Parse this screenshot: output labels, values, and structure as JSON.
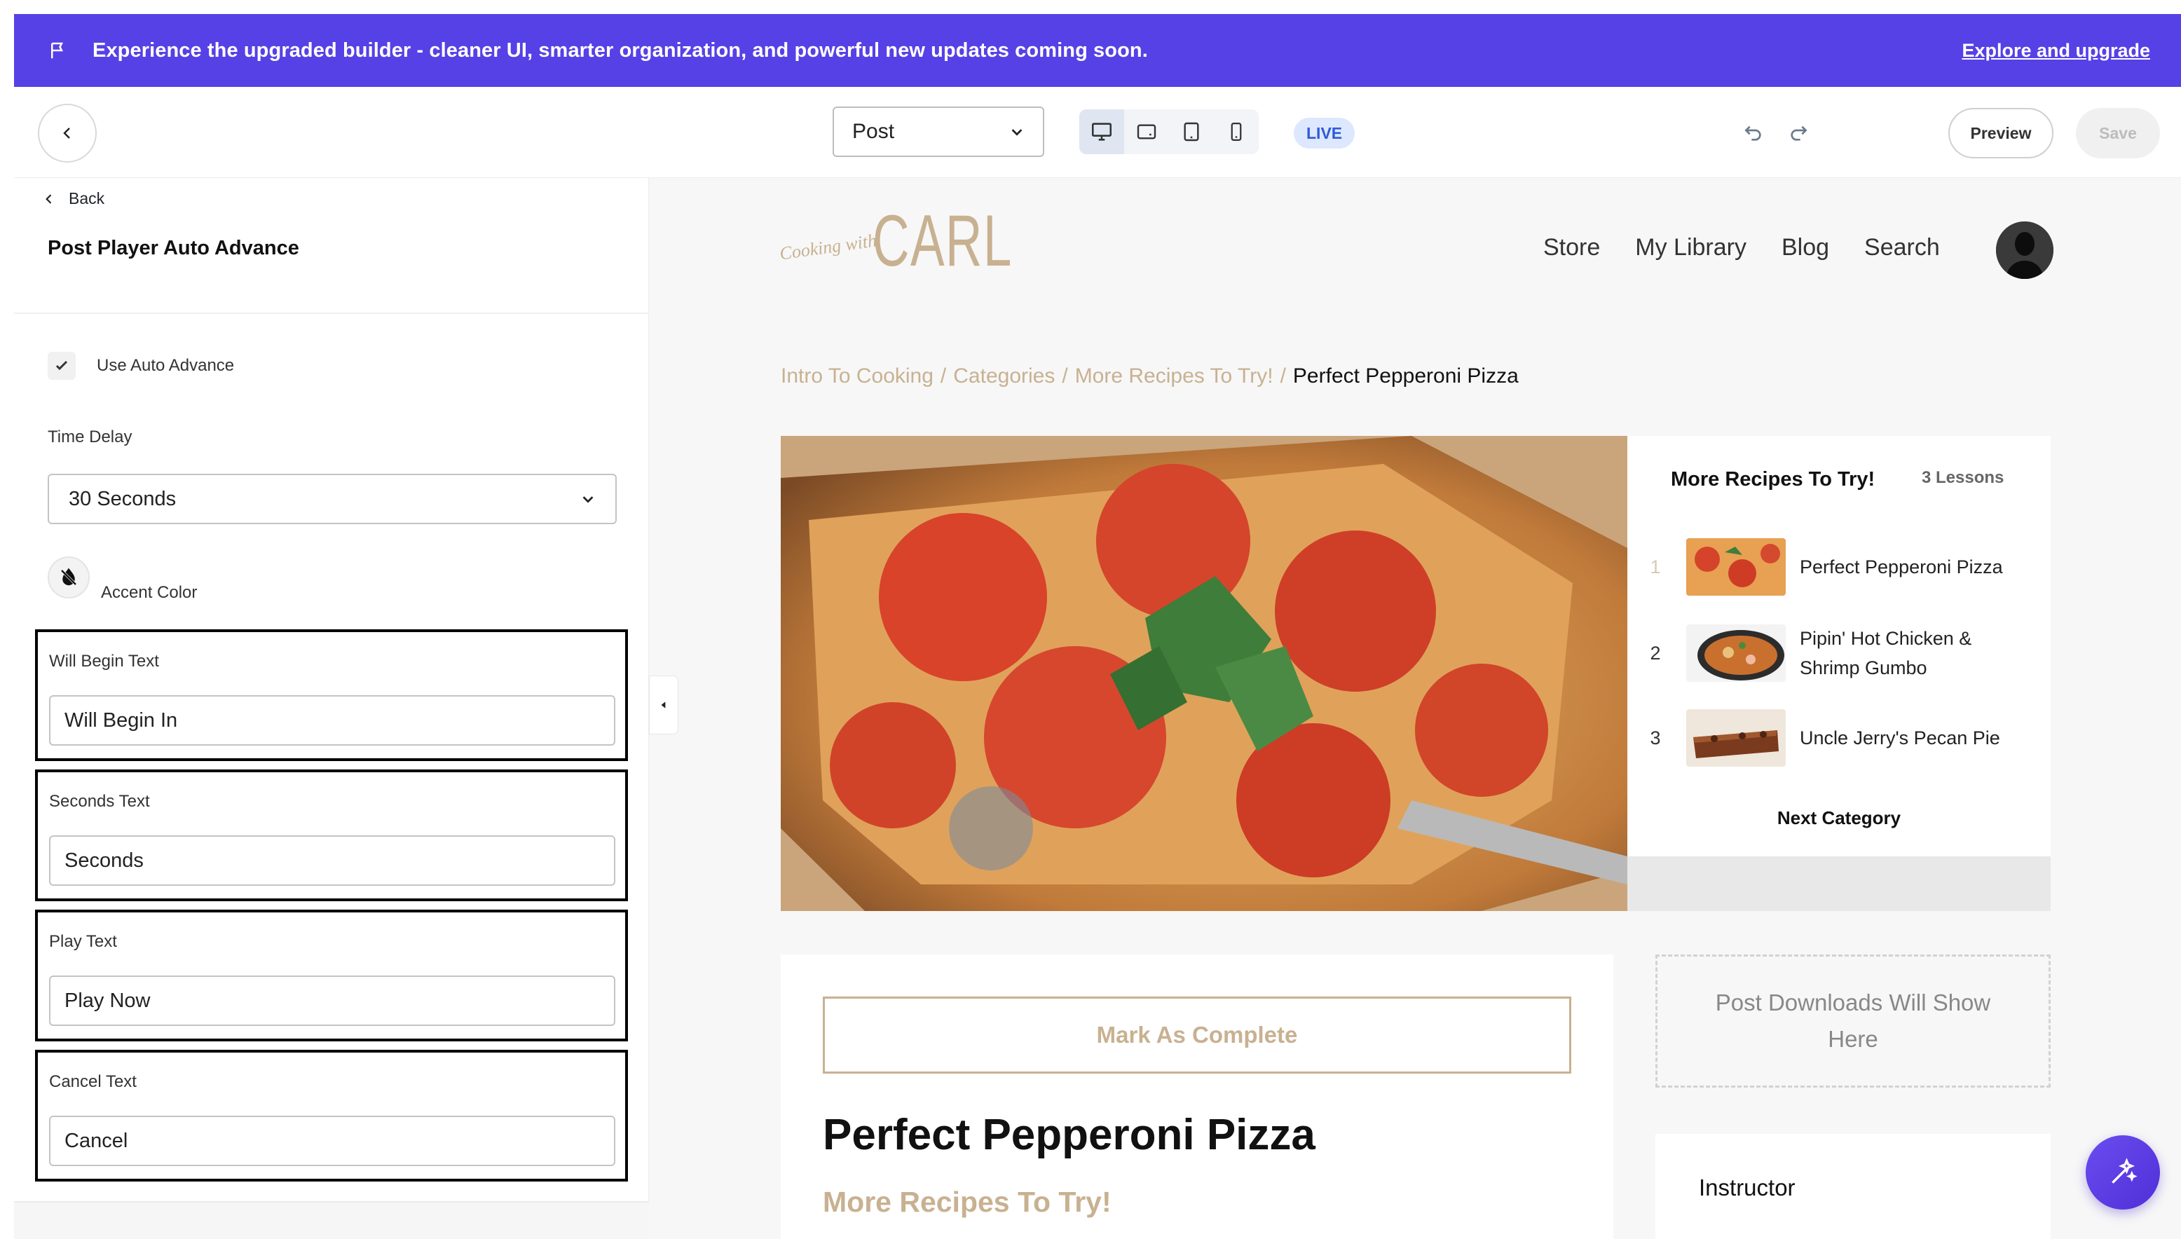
{
  "banner": {
    "message": "Experience the upgraded builder - cleaner UI, smarter organization, and powerful new updates coming soon.",
    "link": "Explore and upgrade",
    "color": "#5641e6"
  },
  "toolbar": {
    "page_type": "Post",
    "live_badge": "LIVE",
    "preview_label": "Preview",
    "save_label": "Save",
    "active_device": "desktop"
  },
  "panel": {
    "back_label": "Back",
    "title": "Post Player Auto Advance",
    "auto_advance_label": "Use Auto Advance",
    "auto_advance_checked": true,
    "time_delay_label": "Time Delay",
    "time_delay_value": "30 Seconds",
    "accent_color_label": "Accent Color",
    "fields": [
      {
        "label": "Will Begin Text",
        "value": "Will Begin In"
      },
      {
        "label": "Seconds Text",
        "value": "Seconds"
      },
      {
        "label": "Play Text",
        "value": "Play Now"
      },
      {
        "label": "Cancel Text",
        "value": "Cancel"
      }
    ]
  },
  "site": {
    "logo_script": "Cooking with",
    "logo_word": "CARL",
    "brand_color": "#c8b191",
    "nav": [
      "Store",
      "My Library",
      "Blog",
      "Search"
    ],
    "breadcrumb": [
      "Intro To Cooking",
      "Categories",
      "More Recipes To Try!"
    ],
    "breadcrumb_current": "Perfect Pepperoni Pizza"
  },
  "sidebar": {
    "title": "More Recipes To Try!",
    "count": "3 Lessons",
    "lessons": [
      {
        "num": "1",
        "title": "Perfect Pepperoni Pizza"
      },
      {
        "num": "2",
        "title": "Pipin' Hot Chicken & Shrimp Gumbo"
      },
      {
        "num": "3",
        "title": "Uncle Jerry's Pecan Pie"
      }
    ],
    "next_label": "Next Category"
  },
  "post": {
    "mark_complete": "Mark As Complete",
    "title": "Perfect Pepperoni Pizza",
    "category": "More Recipes To Try!",
    "downloads_placeholder": "Post Downloads Will Show Here",
    "instructor_label": "Instructor"
  }
}
